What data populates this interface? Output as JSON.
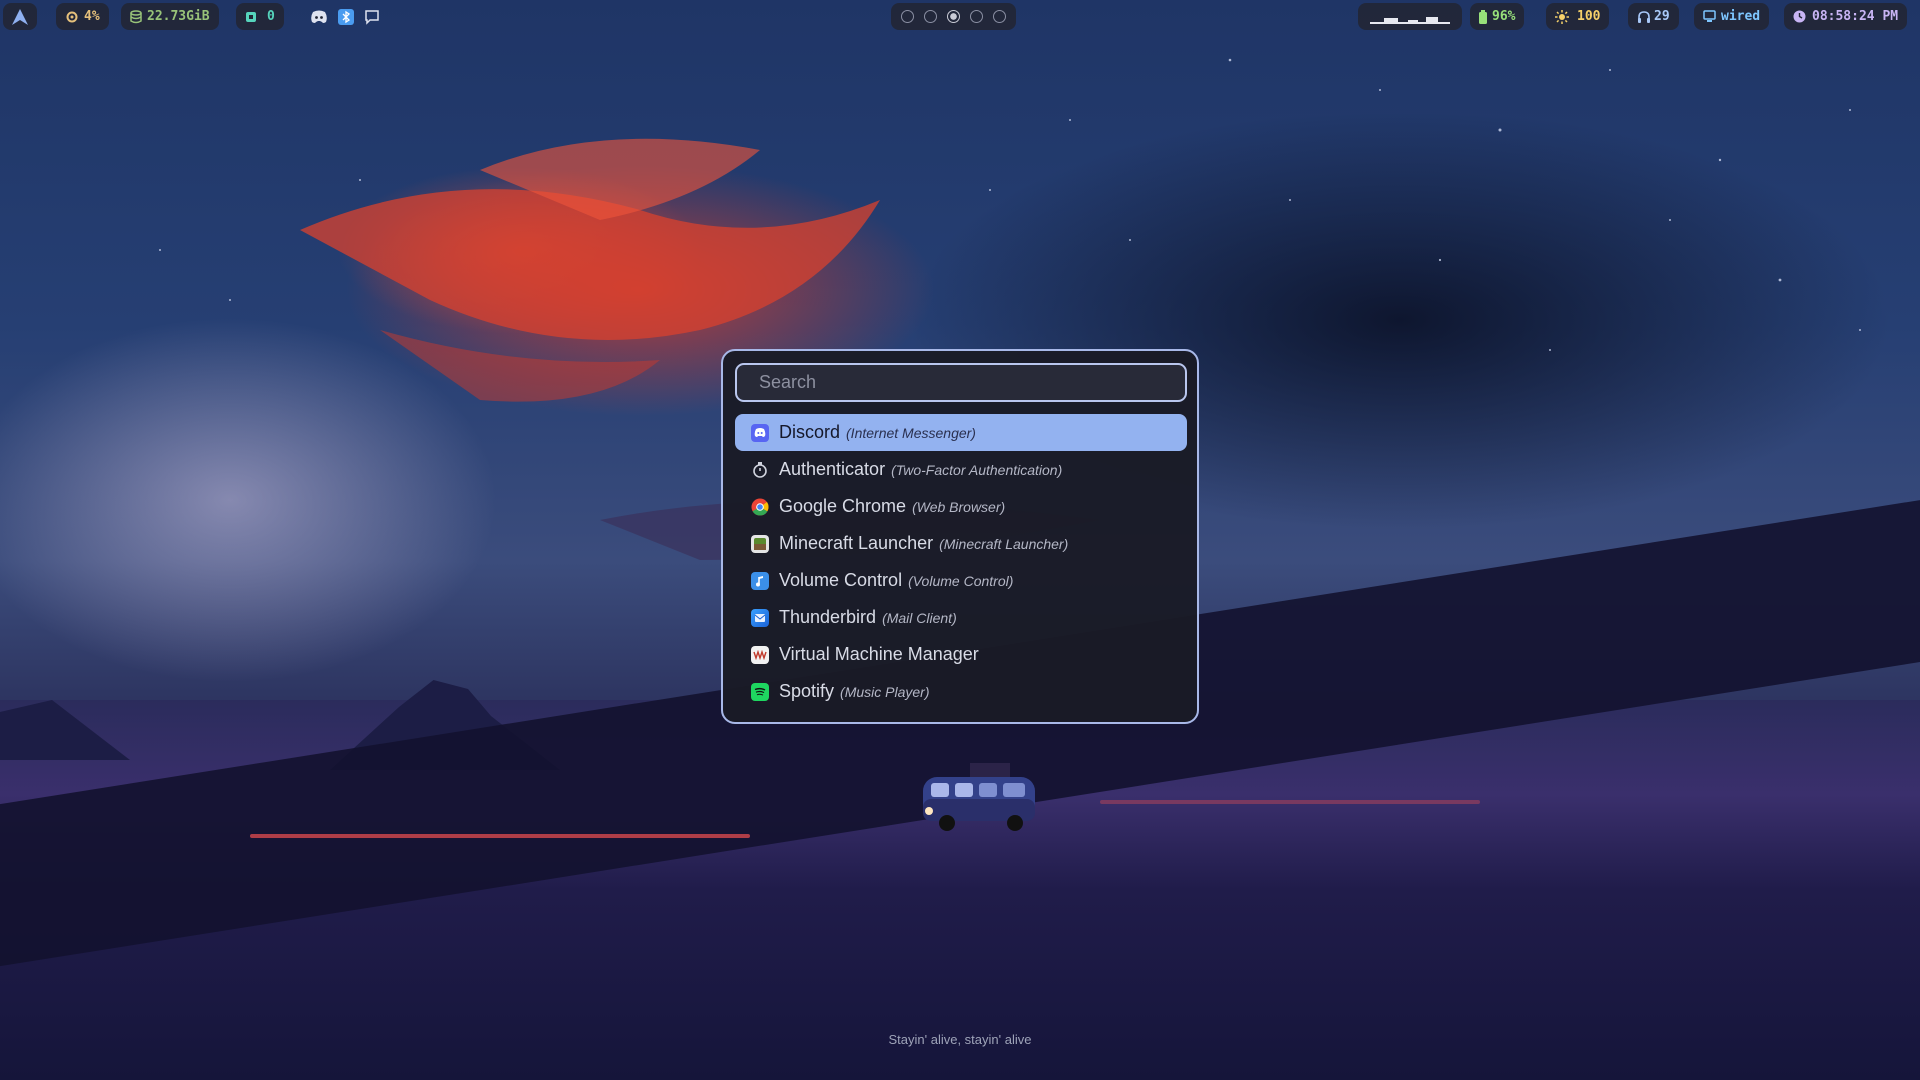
{
  "topbar": {
    "cpu": "4%",
    "memory": "22.73GiB",
    "notifications": "0",
    "brightness": "100",
    "battery": "96%",
    "headset": "29",
    "network": "wired",
    "clock": "08:58:24 PM",
    "workspaces": [
      false,
      false,
      true,
      false,
      false
    ],
    "colors": {
      "cpu": "#e5c07b",
      "memory": "#98c379",
      "notif": "#56d4bc",
      "battery": "#98e07a",
      "brightness": "#f5d06a",
      "headset": "#a8c8f8",
      "network": "#7ec6ff",
      "clock": "#c8b4f4"
    }
  },
  "launcher": {
    "search_placeholder": "Search",
    "items": [
      {
        "name": "Discord",
        "desc": "(Internet Messenger)",
        "icon": "discord-icon",
        "selected": true
      },
      {
        "name": "Authenticator",
        "desc": "(Two-Factor Authentication)",
        "icon": "authenticator-icon",
        "selected": false
      },
      {
        "name": "Google Chrome",
        "desc": "(Web Browser)",
        "icon": "chrome-icon",
        "selected": false
      },
      {
        "name": "Minecraft Launcher",
        "desc": "(Minecraft Launcher)",
        "icon": "minecraft-icon",
        "selected": false
      },
      {
        "name": "Volume Control",
        "desc": "(Volume Control)",
        "icon": "volume-control-icon",
        "selected": false
      },
      {
        "name": "Thunderbird",
        "desc": "(Mail Client)",
        "icon": "thunderbird-icon",
        "selected": false
      },
      {
        "name": "Virtual Machine Manager",
        "desc": "",
        "icon": "virt-manager-icon",
        "selected": false
      },
      {
        "name": "Spotify",
        "desc": "(Music Player)",
        "icon": "spotify-icon",
        "selected": false
      }
    ]
  },
  "caption": "Stayin' alive, stayin' alive"
}
